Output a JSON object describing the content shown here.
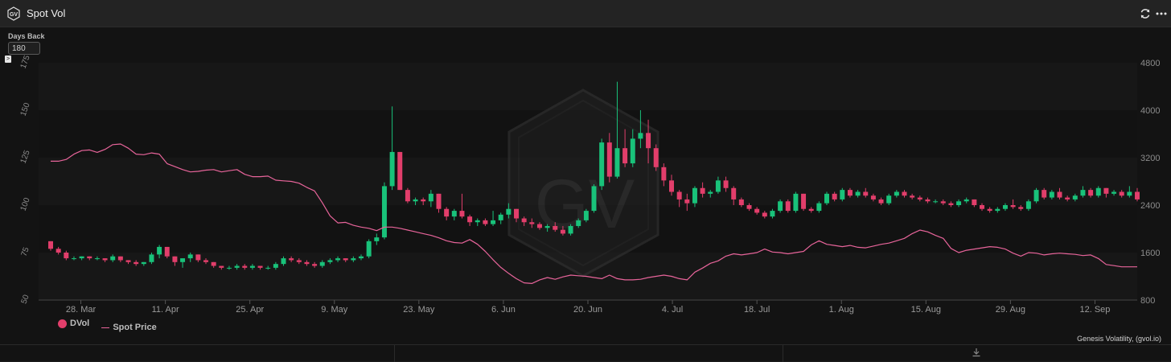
{
  "window": {
    "title": "Spot Vol"
  },
  "controls": {
    "days_back_label": "Days Back",
    "days_back_value": "180",
    "collapse_glyph": ">"
  },
  "legend": {
    "dvol": "DVol",
    "spot": "Spot Price"
  },
  "credit": "Genesis Volatility, (gvol.io)",
  "watermark": {
    "text": "GV"
  },
  "colors": {
    "up": "#19c27a",
    "down": "#e23e6b",
    "spot_line": "#e7649a",
    "background": "#131313"
  },
  "chart_data": {
    "type": "candlestick+line",
    "x_tick_labels": [
      "28. Mar",
      "11. Apr",
      "25. Apr",
      "9. May",
      "23. May",
      "6. Jun",
      "20. Jun",
      "4. Jul",
      "18. Jul",
      "1. Aug",
      "15. Aug",
      "29. Aug",
      "12. Sep"
    ],
    "x_tick_days": [
      7,
      21,
      35,
      49,
      63,
      77,
      91,
      105,
      119,
      133,
      147,
      161,
      175
    ],
    "x_range_days": [
      0,
      182
    ],
    "x_day0": "21. Mar",
    "left_axis": {
      "label_ticks": [
        50,
        75,
        100,
        125,
        150,
        175
      ],
      "range": [
        50,
        175
      ]
    },
    "right_axis": {
      "label_ticks": [
        800,
        1600,
        2400,
        3200,
        4000,
        4800
      ],
      "range": [
        800,
        4800
      ]
    },
    "series": [
      {
        "name": "DVol",
        "type": "candlestick",
        "axis": "left",
        "ohlc": [
          [
            81,
            81,
            76,
            77
          ],
          [
            77,
            78,
            74,
            75
          ],
          [
            75,
            76,
            71,
            72
          ],
          [
            72,
            73,
            71,
            72
          ],
          [
            72,
            73,
            71,
            73
          ],
          [
            73,
            73,
            71,
            72
          ],
          [
            72,
            73,
            71,
            72
          ],
          [
            72,
            72,
            70,
            71
          ],
          [
            71,
            74,
            70,
            73
          ],
          [
            73,
            73,
            70,
            71
          ],
          [
            71,
            71,
            69,
            70
          ],
          [
            70,
            71,
            68,
            69
          ],
          [
            69,
            70,
            68,
            70
          ],
          [
            70,
            75,
            69,
            74
          ],
          [
            74,
            79,
            72,
            78
          ],
          [
            78,
            78,
            72,
            73
          ],
          [
            73,
            73,
            68,
            70
          ],
          [
            70,
            72,
            67,
            72
          ],
          [
            72,
            75,
            70,
            74
          ],
          [
            74,
            74,
            70,
            71
          ],
          [
            71,
            72,
            69,
            70
          ],
          [
            70,
            70,
            67,
            68
          ],
          [
            68,
            68,
            66,
            67
          ],
          [
            67,
            68,
            66,
            67
          ],
          [
            67,
            69,
            66,
            68
          ],
          [
            68,
            69,
            66,
            67
          ],
          [
            67,
            69,
            66,
            68
          ],
          [
            68,
            68,
            66,
            67
          ],
          [
            67,
            68,
            66,
            67
          ],
          [
            67,
            70,
            66,
            69
          ],
          [
            69,
            73,
            68,
            72
          ],
          [
            72,
            73,
            70,
            71
          ],
          [
            71,
            72,
            69,
            70
          ],
          [
            70,
            71,
            68,
            69
          ],
          [
            69,
            70,
            67,
            68
          ],
          [
            68,
            71,
            67,
            70
          ],
          [
            70,
            72,
            69,
            71
          ],
          [
            71,
            73,
            70,
            72
          ],
          [
            72,
            72,
            70,
            71
          ],
          [
            71,
            73,
            70,
            72
          ],
          [
            72,
            74,
            71,
            73
          ],
          [
            73,
            82,
            72,
            81
          ],
          [
            81,
            85,
            79,
            83
          ],
          [
            83,
            112,
            82,
            110
          ],
          [
            110,
            152,
            108,
            128
          ],
          [
            128,
            128,
            108,
            108
          ],
          [
            108,
            109,
            101,
            102
          ],
          [
            102,
            104,
            100,
            103
          ],
          [
            103,
            104,
            100,
            102
          ],
          [
            102,
            108,
            99,
            106
          ],
          [
            106,
            106,
            96,
            98
          ],
          [
            98,
            99,
            92,
            94
          ],
          [
            94,
            98,
            92,
            97
          ],
          [
            97,
            106,
            93,
            94
          ],
          [
            94,
            95,
            89,
            91
          ],
          [
            91,
            93,
            89,
            92
          ],
          [
            92,
            93,
            89,
            90
          ],
          [
            90,
            97,
            89,
            92
          ],
          [
            92,
            96,
            90,
            95
          ],
          [
            95,
            101,
            93,
            98
          ],
          [
            98,
            98,
            91,
            93
          ],
          [
            93,
            94,
            89,
            91
          ],
          [
            91,
            93,
            88,
            90
          ],
          [
            90,
            91,
            87,
            88
          ],
          [
            88,
            90,
            86,
            89
          ],
          [
            89,
            91,
            86,
            87
          ],
          [
            87,
            89,
            84,
            85
          ],
          [
            85,
            90,
            84,
            89
          ],
          [
            89,
            93,
            88,
            92
          ],
          [
            92,
            98,
            91,
            97
          ],
          [
            97,
            111,
            96,
            110
          ],
          [
            110,
            135,
            108,
            133
          ],
          [
            133,
            138,
            112,
            115
          ],
          [
            115,
            165,
            114,
            130
          ],
          [
            130,
            140,
            120,
            122
          ],
          [
            122,
            140,
            120,
            135
          ],
          [
            135,
            150,
            130,
            138
          ],
          [
            138,
            145,
            122,
            130
          ],
          [
            130,
            132,
            118,
            120
          ],
          [
            120,
            122,
            110,
            113
          ],
          [
            113,
            116,
            105,
            107
          ],
          [
            107,
            108,
            99,
            103
          ],
          [
            103,
            106,
            97,
            101
          ],
          [
            101,
            110,
            99,
            109
          ],
          [
            109,
            112,
            104,
            106
          ],
          [
            106,
            108,
            104,
            107
          ],
          [
            107,
            115,
            106,
            113
          ],
          [
            113,
            115,
            107,
            109
          ],
          [
            109,
            110,
            100,
            103
          ],
          [
            103,
            104,
            99,
            100
          ],
          [
            100,
            101,
            97,
            98
          ],
          [
            98,
            99,
            95,
            96
          ],
          [
            96,
            97,
            93,
            94
          ],
          [
            94,
            98,
            93,
            97
          ],
          [
            97,
            103,
            96,
            102
          ],
          [
            102,
            103,
            96,
            97
          ],
          [
            97,
            107,
            96,
            106
          ],
          [
            106,
            106,
            97,
            98
          ],
          [
            98,
            99,
            96,
            97
          ],
          [
            97,
            102,
            96,
            101
          ],
          [
            101,
            107,
            100,
            106
          ],
          [
            106,
            107,
            102,
            103
          ],
          [
            103,
            109,
            102,
            108
          ],
          [
            108,
            109,
            104,
            105
          ],
          [
            105,
            108,
            104,
            107
          ],
          [
            107,
            109,
            104,
            105
          ],
          [
            105,
            106,
            102,
            103
          ],
          [
            103,
            104,
            100,
            101
          ],
          [
            101,
            106,
            100,
            105
          ],
          [
            105,
            108,
            104,
            107
          ],
          [
            107,
            108,
            104,
            105
          ],
          [
            105,
            106,
            103,
            104
          ],
          [
            104,
            105,
            102,
            103
          ],
          [
            103,
            104,
            101,
            102
          ],
          [
            102,
            103,
            101,
            102
          ],
          [
            102,
            103,
            100,
            101
          ],
          [
            101,
            102,
            99,
            100
          ],
          [
            100,
            103,
            99,
            102
          ],
          [
            102,
            104,
            101,
            103
          ],
          [
            103,
            103,
            99,
            100
          ],
          [
            100,
            101,
            97,
            98
          ],
          [
            98,
            99,
            96,
            97
          ],
          [
            97,
            99,
            96,
            98
          ],
          [
            98,
            101,
            97,
            100
          ],
          [
            100,
            103,
            98,
            99
          ],
          [
            99,
            100,
            97,
            98
          ],
          [
            98,
            103,
            97,
            102
          ],
          [
            102,
            109,
            101,
            108
          ],
          [
            108,
            109,
            103,
            104
          ],
          [
            104,
            108,
            103,
            107
          ],
          [
            107,
            109,
            103,
            104
          ],
          [
            104,
            105,
            102,
            103
          ],
          [
            103,
            106,
            102,
            105
          ],
          [
            105,
            110,
            104,
            108
          ],
          [
            108,
            109,
            104,
            105
          ],
          [
            105,
            110,
            104,
            109
          ],
          [
            109,
            109,
            104,
            106
          ],
          [
            106,
            108,
            105,
            107
          ],
          [
            107,
            108,
            104,
            105
          ],
          [
            105,
            110,
            104,
            107
          ],
          [
            107,
            109,
            102,
            103
          ]
        ]
      },
      {
        "name": "Spot Price",
        "type": "line",
        "axis": "right",
        "values": [
          3140,
          3140,
          3170,
          3260,
          3320,
          3330,
          3290,
          3340,
          3420,
          3430,
          3360,
          3260,
          3250,
          3280,
          3260,
          3100,
          3050,
          3000,
          2960,
          2970,
          2990,
          3000,
          2960,
          2980,
          3000,
          2920,
          2880,
          2880,
          2890,
          2820,
          2810,
          2800,
          2770,
          2700,
          2640,
          2440,
          2220,
          2100,
          2110,
          2060,
          2030,
          2010,
          1970,
          2030,
          2030,
          2010,
          1980,
          1950,
          1920,
          1890,
          1850,
          1800,
          1770,
          1760,
          1820,
          1740,
          1620,
          1480,
          1350,
          1250,
          1160,
          1090,
          1080,
          1140,
          1180,
          1150,
          1190,
          1220,
          1210,
          1200,
          1180,
          1160,
          1220,
          1160,
          1140,
          1140,
          1150,
          1180,
          1200,
          1220,
          1200,
          1160,
          1140,
          1270,
          1340,
          1420,
          1460,
          1540,
          1580,
          1560,
          1580,
          1600,
          1660,
          1610,
          1600,
          1580,
          1600,
          1620,
          1730,
          1800,
          1740,
          1720,
          1700,
          1720,
          1690,
          1680,
          1710,
          1740,
          1760,
          1800,
          1840,
          1920,
          1980,
          1950,
          1890,
          1840,
          1670,
          1600,
          1640,
          1660,
          1680,
          1700,
          1690,
          1660,
          1590,
          1540,
          1600,
          1590,
          1560,
          1580,
          1590,
          1580,
          1570,
          1550,
          1560,
          1500,
          1400,
          1380,
          1360,
          1360,
          1360
        ]
      }
    ]
  }
}
